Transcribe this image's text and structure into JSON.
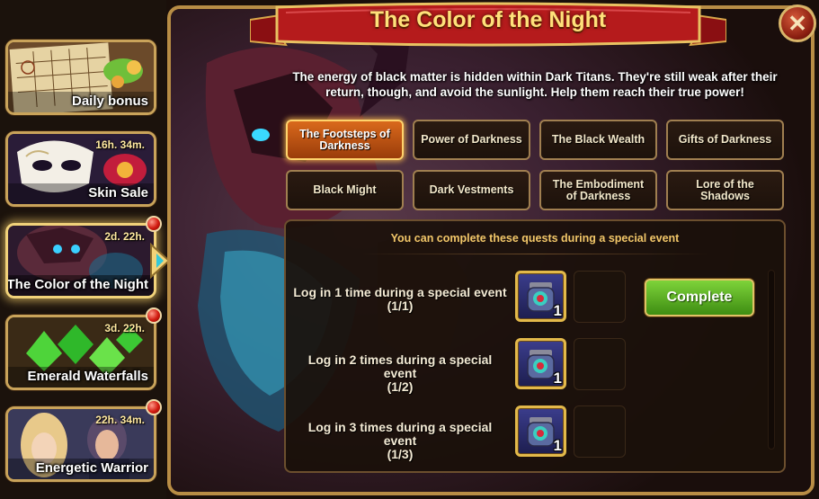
{
  "sidebar": {
    "events": [
      {
        "title": "Daily bonus",
        "timer": "",
        "notification": false,
        "active": false
      },
      {
        "title": "Skin Sale",
        "timer": "16h. 34m.",
        "notification": false,
        "active": false
      },
      {
        "title": "The Color of the Night",
        "timer": "2d. 22h.",
        "notification": true,
        "active": true
      },
      {
        "title": "Emerald Waterfalls",
        "timer": "3d. 22h.",
        "notification": true,
        "active": false
      },
      {
        "title": "Energetic Warrior",
        "timer": "22h. 34m.",
        "notification": true,
        "active": false
      }
    ]
  },
  "header": {
    "title": "The Color of the Night",
    "close_icon": "close-icon"
  },
  "description": "The energy of black matter is hidden within Dark Titans. They're still weak after their return, though, and avoid the sunlight. Help them reach their true power!",
  "tabs": [
    {
      "label": "The Footsteps of Darkness",
      "active": true
    },
    {
      "label": "Power of Darkness",
      "active": false
    },
    {
      "label": "The Black Wealth",
      "active": false
    },
    {
      "label": "Gifts of Darkness",
      "active": false
    },
    {
      "label": "Black Might",
      "active": false
    },
    {
      "label": "Dark Vestments",
      "active": false
    },
    {
      "label": "The Embodiment of Darkness",
      "active": false
    },
    {
      "label": "Lore of the Shadows",
      "active": false
    }
  ],
  "quests": {
    "header": "You can complete these quests during a special event",
    "items": [
      {
        "text": "Log in 1 time during a special event",
        "progress": "(1/1)",
        "reward_count": "1",
        "action": "Complete"
      },
      {
        "text": "Log in 2 times during a special event",
        "progress": "(1/2)",
        "reward_count": "1",
        "action": ""
      },
      {
        "text": "Log in 3 times during a special event",
        "progress": "(1/3)",
        "reward_count": "1",
        "action": ""
      }
    ]
  },
  "colors": {
    "gold_text": "#ffe17a",
    "active_tab": "#d9691c",
    "complete_green": "#5fb52a",
    "notification_red": "#d11a0f"
  }
}
